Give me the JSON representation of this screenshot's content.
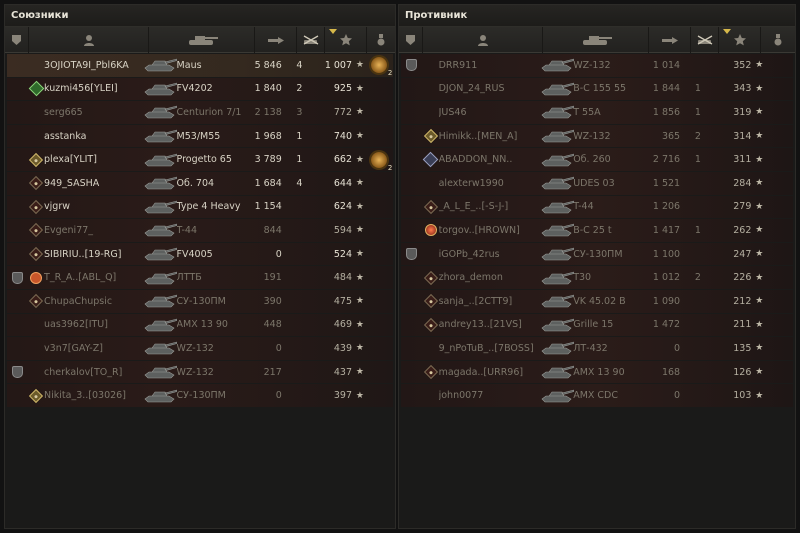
{
  "allies": {
    "title": "Союзники",
    "rows": [
      {
        "name": "3OJIOTA9I_Pbl6KA",
        "tank": "Maus",
        "damage": "5 846",
        "kills": "4",
        "xp": "1 007",
        "highlight": true,
        "medal": "",
        "platoon": false,
        "achievement": true,
        "dead": false
      },
      {
        "name": "kuzmi456[YLEI]",
        "tank": "FV4202",
        "damage": "1 840",
        "kills": "2",
        "xp": "925",
        "medal": "green",
        "platoon": false,
        "achievement": false,
        "dead": false
      },
      {
        "name": "serg665",
        "tank": "Centurion 7/1",
        "damage": "2 138",
        "kills": "3",
        "xp": "772",
        "medal": "",
        "platoon": false,
        "achievement": false,
        "dead": true
      },
      {
        "name": "asstanka",
        "tank": "M53/M55",
        "damage": "1 968",
        "kills": "1",
        "xp": "740",
        "medal": "",
        "platoon": false,
        "achievement": false,
        "dead": false
      },
      {
        "name": "plexa[YLIT]",
        "tank": "Progetto 65",
        "damage": "3 789",
        "kills": "1",
        "xp": "662",
        "medal": "gold",
        "platoon": false,
        "achievement": true,
        "dead": false
      },
      {
        "name": "949_SASHA",
        "tank": "Об. 704",
        "damage": "1 684",
        "kills": "4",
        "xp": "644",
        "medal": "diamond",
        "platoon": false,
        "achievement": false,
        "dead": false
      },
      {
        "name": "vjgrw",
        "tank": "Type 4 Heavy",
        "damage": "1 154",
        "kills": "",
        "xp": "624",
        "medal": "diamond",
        "platoon": false,
        "achievement": false,
        "dead": false
      },
      {
        "name": "Evgeni77_",
        "tank": "T-44",
        "damage": "844",
        "kills": "",
        "xp": "594",
        "medal": "diamond",
        "platoon": false,
        "achievement": false,
        "dead": true
      },
      {
        "name": "SIBIRIU..[19-RG]",
        "tank": "FV4005",
        "damage": "0",
        "kills": "",
        "xp": "524",
        "medal": "diamond",
        "platoon": false,
        "achievement": false,
        "dead": false
      },
      {
        "name": "T_R_A..[ABL_Q]",
        "tank": "ЛТТБ",
        "damage": "191",
        "kills": "",
        "xp": "484",
        "medal": "red",
        "platoon": true,
        "achievement": false,
        "dead": true
      },
      {
        "name": "ChupaChupsic",
        "tank": "СУ-130ПМ",
        "damage": "390",
        "kills": "",
        "xp": "475",
        "medal": "diamond",
        "platoon": false,
        "achievement": false,
        "dead": true
      },
      {
        "name": "uas3962[ITU]",
        "tank": "AMX 13 90",
        "damage": "448",
        "kills": "",
        "xp": "469",
        "medal": "",
        "platoon": false,
        "achievement": false,
        "dead": true
      },
      {
        "name": "v3n7[GAY-Z]",
        "tank": "WZ-132",
        "damage": "0",
        "kills": "",
        "xp": "439",
        "medal": "",
        "platoon": false,
        "achievement": false,
        "dead": true
      },
      {
        "name": "cherkalov[TO_R]",
        "tank": "WZ-132",
        "damage": "217",
        "kills": "",
        "xp": "437",
        "medal": "",
        "platoon": true,
        "achievement": false,
        "dead": true
      },
      {
        "name": "Nikita_3..[03026]",
        "tank": "СУ-130ПМ",
        "damage": "0",
        "kills": "",
        "xp": "397",
        "medal": "gold",
        "platoon": false,
        "achievement": false,
        "dead": true
      }
    ]
  },
  "enemies": {
    "title": "Противник",
    "rows": [
      {
        "name": "DRR911",
        "tank": "WZ-132",
        "damage": "1 014",
        "kills": "",
        "xp": "352",
        "medal": "",
        "platoon": true,
        "dead": true
      },
      {
        "name": "DJON_24_RUS",
        "tank": "B-C 155 55",
        "damage": "1 844",
        "kills": "1",
        "xp": "343",
        "medal": "",
        "platoon": false,
        "dead": true
      },
      {
        "name": "JUS46",
        "tank": "T 55A",
        "damage": "1 856",
        "kills": "1",
        "xp": "319",
        "medal": "",
        "platoon": false,
        "dead": true
      },
      {
        "name": "Himikk..[MEN_A]",
        "tank": "WZ-132",
        "damage": "365",
        "kills": "2",
        "xp": "314",
        "medal": "gold",
        "platoon": false,
        "dead": true
      },
      {
        "name": "ABADDON_NN..",
        "tank": "Об. 260",
        "damage": "2 716",
        "kills": "1",
        "xp": "311",
        "medal": "x",
        "platoon": false,
        "dead": true
      },
      {
        "name": "alexterw1990",
        "tank": "UDES 03",
        "damage": "1 521",
        "kills": "",
        "xp": "284",
        "medal": "",
        "platoon": false,
        "dead": true
      },
      {
        "name": "_A_L_E_..[-S-J-]",
        "tank": "T-44",
        "damage": "1 206",
        "kills": "",
        "xp": "279",
        "medal": "diamond",
        "platoon": false,
        "dead": true
      },
      {
        "name": "torgov..[HROWN]",
        "tank": "B-C 25 t",
        "damage": "1 417",
        "kills": "1",
        "xp": "262",
        "medal": "jewel",
        "platoon": false,
        "dead": true
      },
      {
        "name": "iGOPb_42rus",
        "tank": "СУ-130ПМ",
        "damage": "1 100",
        "kills": "",
        "xp": "247",
        "medal": "",
        "platoon": true,
        "dead": true
      },
      {
        "name": "zhora_demon",
        "tank": "T30",
        "damage": "1 012",
        "kills": "2",
        "xp": "226",
        "medal": "diamond",
        "platoon": false,
        "dead": true
      },
      {
        "name": "sanja_..[2CTT9]",
        "tank": "VK 45.02 B",
        "damage": "1 090",
        "kills": "",
        "xp": "212",
        "medal": "diamond",
        "platoon": false,
        "dead": true
      },
      {
        "name": "andrey13..[21VS]",
        "tank": "Grille 15",
        "damage": "1 472",
        "kills": "",
        "xp": "211",
        "medal": "diamond",
        "platoon": false,
        "dead": true
      },
      {
        "name": "9_nPoTuB_..[7BOSS]",
        "tank": "ЛТ-432",
        "damage": "0",
        "kills": "",
        "xp": "135",
        "medal": "",
        "platoon": false,
        "dead": true
      },
      {
        "name": "magada..[URR96]",
        "tank": "AMX 13 90",
        "damage": "168",
        "kills": "",
        "xp": "126",
        "medal": "diamond",
        "platoon": false,
        "dead": true
      },
      {
        "name": "john0077",
        "tank": "AMX CDC",
        "damage": "0",
        "kills": "",
        "xp": "103",
        "medal": "",
        "platoon": false,
        "dead": true
      }
    ]
  },
  "columns": [
    "platoon-icon",
    "player-icon",
    "tank-icon",
    "damage-icon",
    "kills-icon",
    "sort-arrow-icon",
    "xp-star-icon",
    "medal-icon"
  ],
  "star_glyph": "★",
  "achievement_count": "2",
  "colors": {
    "panel_bg": "#1a1a19",
    "row_red": "#2a1b18",
    "highlight": "#3b2c22",
    "text": "#d8d3c5",
    "dead_text": "#7c766a"
  }
}
